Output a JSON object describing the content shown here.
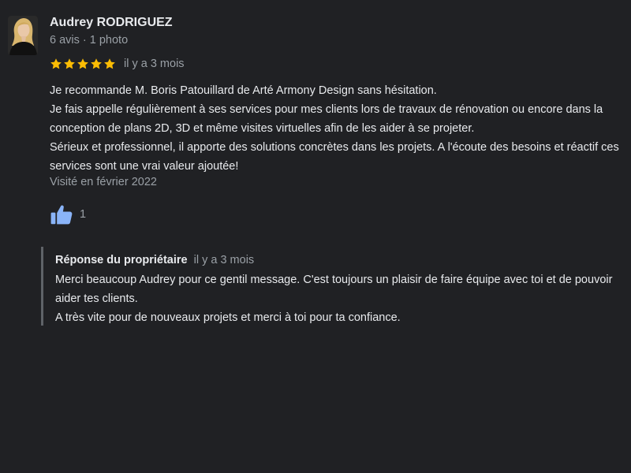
{
  "review": {
    "author": {
      "name": "Audrey RODRIGUEZ",
      "meta": "6 avis · 1 photo"
    },
    "rating": 5,
    "rating_max": 5,
    "time": "il y a 3 mois",
    "text_lines": [
      "Je recommande M. Boris Patouillard de Arté Armony Design sans hésitation.",
      "Je fais appelle régulièrement à ses services pour mes clients lors de travaux de rénovation ou encore dans la conception de plans 2D, 3D et même visites virtuelles afin de les aider à se projeter.",
      "Sérieux et professionnel, il apporte des solutions concrètes dans les projets. A l'écoute des besoins et réactif ces services sont une vrai valeur ajoutée!"
    ],
    "visited": "Visité en février 2022",
    "likes": "1"
  },
  "owner_response": {
    "label": "Réponse du propriétaire",
    "time": "il y a 3 mois",
    "text_lines": [
      "Merci beaucoup Audrey pour ce gentil message. C'est toujours un plaisir de faire équipe avec toi et de pouvoir aider tes clients.",
      "A très vite pour de nouveaux projets et merci à toi pour ta confiance."
    ]
  },
  "colors": {
    "background": "#202124",
    "star": "#fbbc04",
    "like": "#8ab4f8",
    "secondary_text": "#9aa0a6",
    "primary_text": "#e8eaed"
  },
  "icons": {
    "avatar": "user-photo",
    "star": "star-icon",
    "like": "thumbs-up-icon"
  }
}
